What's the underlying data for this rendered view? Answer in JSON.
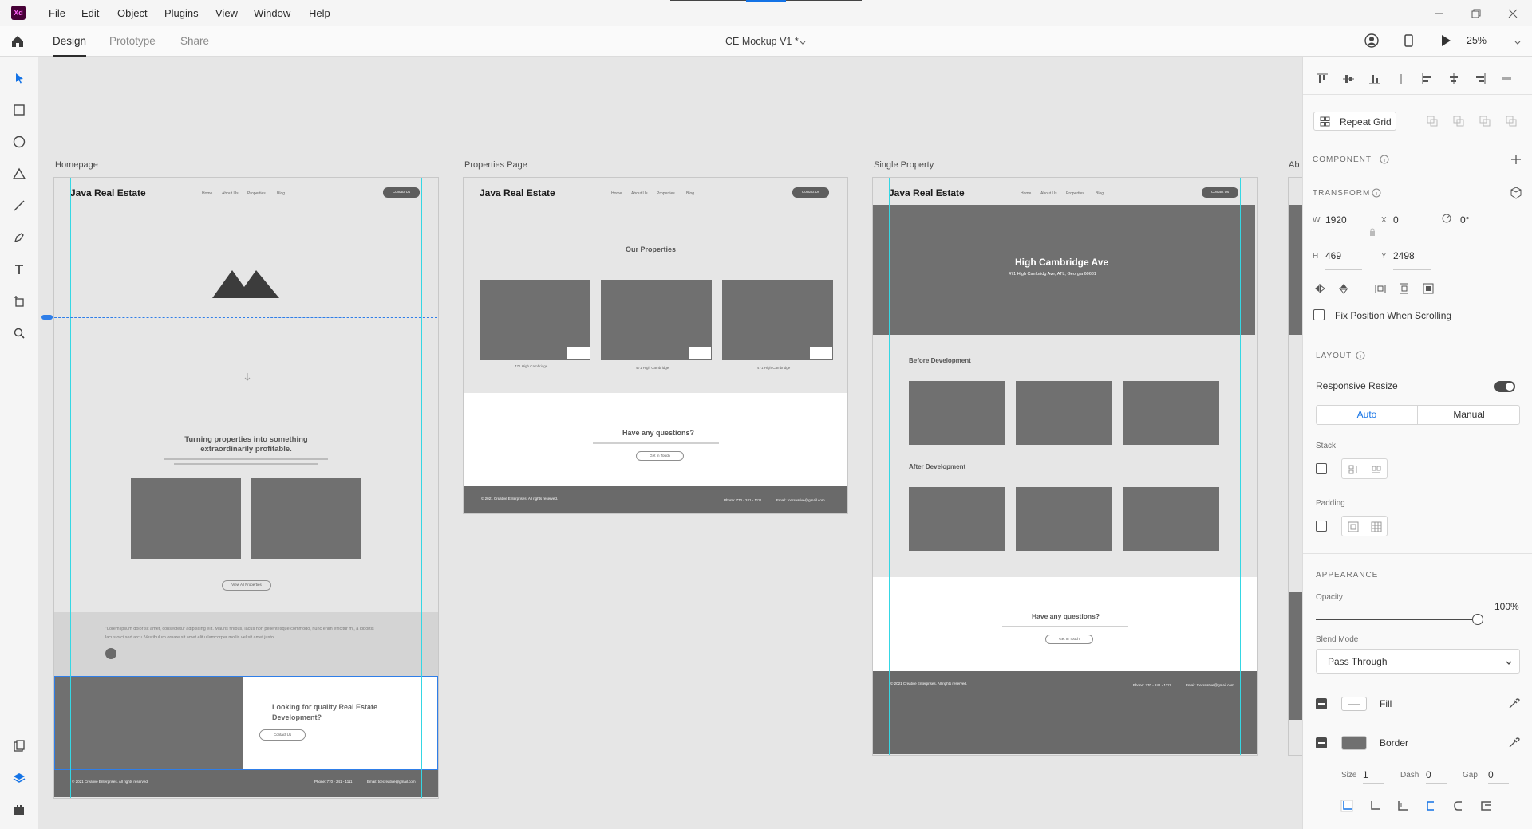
{
  "app": {
    "badge": "Xd",
    "colors": {
      "brand": "#470137",
      "brand_text": "#ff61f6",
      "accent": "#1473e6",
      "guide": "#35d7e4"
    }
  },
  "menu": [
    "File",
    "Edit",
    "Object",
    "Plugins",
    "View",
    "Window",
    "Help"
  ],
  "modes": {
    "design": "Design",
    "prototype": "Prototype",
    "share": "Share"
  },
  "document": {
    "title": "CE Mockup V1 *"
  },
  "zoom": "25%",
  "artboards": {
    "homepage": {
      "label": "Homepage",
      "logo": "Java Real Estate",
      "nav": [
        "Home",
        "About Us",
        "Properties",
        "Blog"
      ],
      "contact": "Contact Us",
      "headline": "Turning properties into something extraordinarily profitable.",
      "view_all": "View All Properties",
      "quote": "\"Lorem ipsum dolor sit amet, consectetur adipiscing elit. Mauris finibus, lacus non pellentesque commodo, nunc enim efficitur mi, a lobortis lacus orci sed arcu. Vestibulum ornare sit amet elit ullamcorper mollis vel sit amet justo.",
      "cta": "Looking for quality Real Estate Development?",
      "cta_button": "Contact Us",
      "footer_left": "© 2021 Creative Enterprises. All rights reserved.",
      "footer_phone": "Phone: 770 - 241 - 1111",
      "footer_email": "Email: tcecreative@gmail.com"
    },
    "properties": {
      "label": "Properties Page",
      "logo": "Java Real Estate",
      "nav": [
        "Home",
        "About Us",
        "Properties",
        "Blog"
      ],
      "contact": "Contact Us",
      "heading": "Our Properties",
      "cards": [
        "471 High Cambridge",
        "471 High Cambridge",
        "471 High Cambridge"
      ],
      "question": "Have any questions?",
      "question_button": "Get In Touch",
      "footer_left": "© 2021 Creative Enterprises. All rights reserved.",
      "footer_phone": "Phone: 770 - 241 - 1111",
      "footer_email": "Email: tcecreative@gmail.com"
    },
    "single": {
      "label": "Single Property",
      "logo": "Java Real Estate",
      "nav": [
        "Home",
        "About Us",
        "Properties",
        "Blog"
      ],
      "contact": "Contact Us",
      "hero_title": "High Cambridge Ave",
      "hero_address": "471 High Cambridg Ave, ATL, Georgia 60631",
      "before": "Before Development",
      "after": "After Development",
      "question": "Have any questions?",
      "question_button": "Get In Touch",
      "footer_left": "© 2021 Creative Enterprises. All rights reserved.",
      "footer_phone": "Phone: 770 - 241 - 1111",
      "footer_email": "Email: tcecreative@gmail.com"
    },
    "partial_label": "Ab"
  },
  "panel": {
    "repeat_grid": "Repeat Grid",
    "component": "COMPONENT",
    "transform": "TRANSFORM",
    "w_label": "W",
    "w": "1920",
    "x_label": "X",
    "x": "0",
    "rotation": "0°",
    "h_label": "H",
    "h": "469",
    "y_label": "Y",
    "y": "2498",
    "fix_position": "Fix Position When Scrolling",
    "layout": "LAYOUT",
    "responsive_resize": "Responsive Resize",
    "auto": "Auto",
    "manual": "Manual",
    "stack": "Stack",
    "padding": "Padding",
    "appearance": "APPEARANCE",
    "opacity_label": "Opacity",
    "opacity": "100%",
    "opacity_fraction": 1.0,
    "blend_label": "Blend Mode",
    "blend": "Pass Through",
    "fill": "Fill",
    "border": "Border",
    "size_label": "Size",
    "size": "1",
    "dash_label": "Dash",
    "dash": "0",
    "gap_label": "Gap",
    "gap": "0"
  }
}
